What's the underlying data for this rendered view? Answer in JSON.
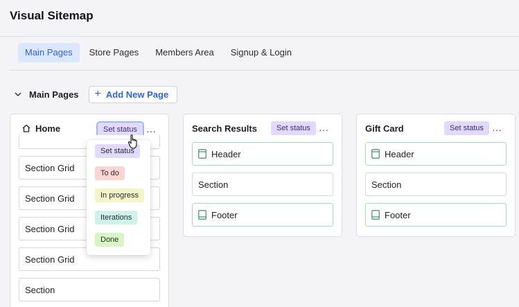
{
  "app": {
    "title": "Visual Sitemap"
  },
  "tabs": [
    {
      "label": "Main Pages"
    },
    {
      "label": "Store Pages"
    },
    {
      "label": "Members Area"
    },
    {
      "label": "Signup & Login"
    }
  ],
  "section": {
    "title": "Main Pages",
    "add_label": "Add New Page",
    "add_icon": "plus-icon"
  },
  "cards": {
    "home": {
      "title": "Home",
      "status": "Set status",
      "blocks": [
        "Section Grid",
        "Section Grid",
        "Section Grid",
        "Section Grid",
        "Section"
      ]
    },
    "search": {
      "title": "Search Results",
      "status": "Set status",
      "header": "Header",
      "section": "Section",
      "footer": "Footer"
    },
    "gift": {
      "title": "Gift Card",
      "status": "Set status",
      "header": "Header",
      "section": "Section",
      "footer": "Footer"
    }
  },
  "status_menu": {
    "options": [
      {
        "label": "Set status",
        "color": "#e2dafc"
      },
      {
        "label": "To do",
        "color": "#fbd4d4"
      },
      {
        "label": "In progress",
        "color": "#f3f5c6"
      },
      {
        "label": "Iterations",
        "color": "#cff3ea"
      },
      {
        "label": "Done",
        "color": "#d8f5c4"
      }
    ]
  },
  "colors": {
    "accent": "#2f62e6",
    "tab_active_bg": "#dbe7ff"
  },
  "more_glyph": "···"
}
